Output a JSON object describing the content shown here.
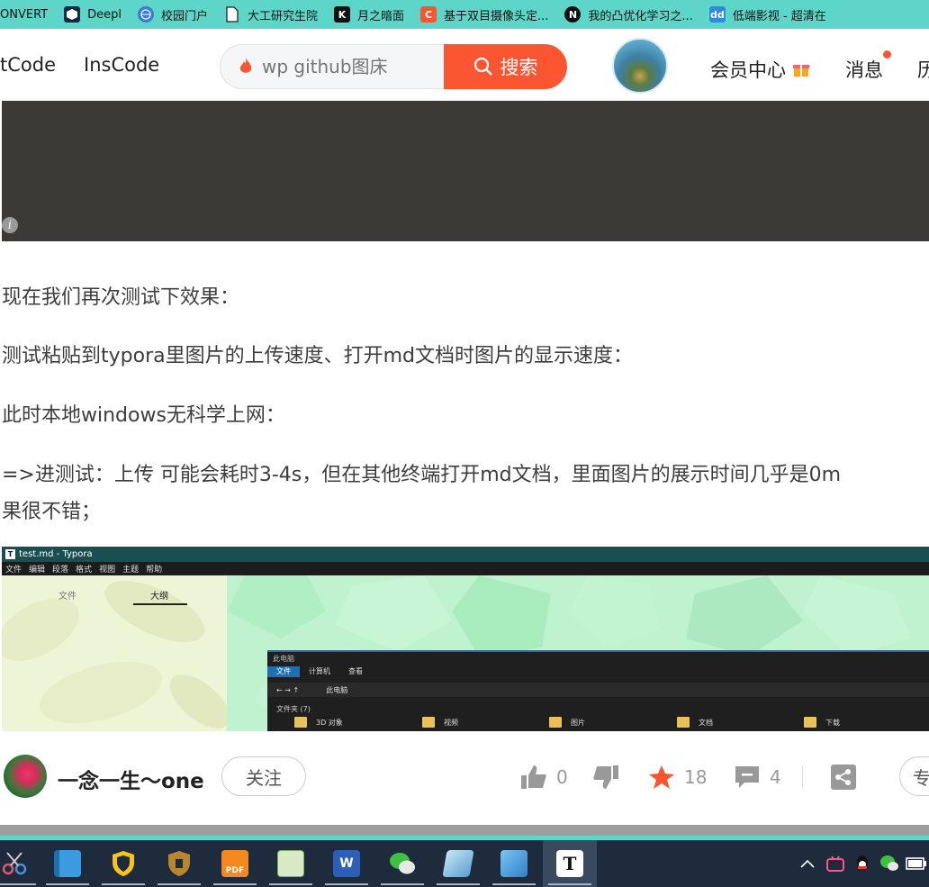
{
  "bookmarks": [
    {
      "label": "ONVERT",
      "icon": "none"
    },
    {
      "label": "Deepl",
      "icon": "deepl-icon",
      "color": "#0f2b46"
    },
    {
      "label": "校园门户",
      "icon": "globe-icon",
      "color": "#3b7bd6"
    },
    {
      "label": "大工研究生院",
      "icon": "page-icon",
      "color": "#ffffff"
    },
    {
      "label": "月之暗面",
      "icon": "kimi-icon",
      "color": "#111111"
    },
    {
      "label": "基于双目摄像头定...",
      "icon": "csdn-icon",
      "color": "#fc5531"
    },
    {
      "label": "我的凸优化学习之...",
      "icon": "notion-icon",
      "color": "#111111"
    },
    {
      "label": "低端影视 - 超清在",
      "icon": "dd-icon",
      "color": "#2f8be0"
    }
  ],
  "header": {
    "nav": [
      "tCode",
      "InsCode"
    ],
    "search_placeholder": "wp github图床",
    "search_button": "搜索",
    "member_center": "会员中心",
    "messages": "消息",
    "history_partial": "历"
  },
  "article": {
    "paragraphs": [
      "现在我们再次测试下效果：",
      "测试粘贴到typora里图片的上传速度、打开md文档时图片的显示速度：",
      "此时本地windows无科学上网：",
      "=>进测试：上传 可能会耗时3-4s，但在其他终端打开md文档，里面图片的展示时间几乎是0m",
      "果很不错；"
    ]
  },
  "typora_shot": {
    "title": "test.md - Typora",
    "menu": [
      "文件",
      "编辑",
      "段落",
      "格式",
      "视图",
      "主题",
      "帮助"
    ],
    "sidebar_tabs": [
      "文件",
      "大纲"
    ],
    "explorer": {
      "title": "此电脑",
      "tabs": [
        "文件",
        "计算机",
        "查看"
      ],
      "address": "此电脑",
      "group": "文件夹 (7)",
      "items": [
        "3D 对象",
        "视频",
        "图片",
        "文档",
        "下载"
      ]
    }
  },
  "author_bar": {
    "name": "一念一生～one",
    "follow": "关注",
    "likes": "0",
    "stars": "18",
    "comments": "4",
    "more_partial": "专"
  },
  "colors": {
    "bookmark_bar": "#5dd6c9",
    "accent": "#fc5531",
    "taskbar": "#1e2b3c"
  },
  "taskbar": {
    "apps": [
      "scissors-icon",
      "file-explorer-icon",
      "security-shield-icon",
      "vpn-shield-icon",
      "foxit-pdf-icon",
      "notepad-icon",
      "word-icon",
      "wechat-icon",
      "vps-icon",
      "photos-icon",
      "typora-icon"
    ],
    "tray": [
      "chevron-up-icon",
      "bilibili-icon",
      "qq-icon",
      "wechat-tray-icon",
      "battery-icon"
    ]
  }
}
